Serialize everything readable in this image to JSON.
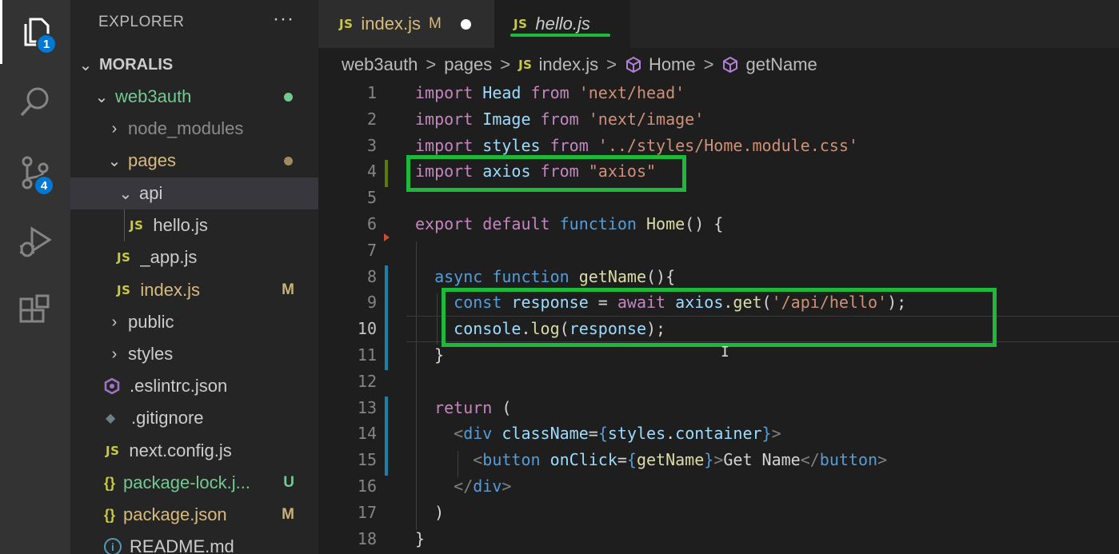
{
  "activity_bar": {
    "explorer_badge": "1",
    "scm_badge": "4"
  },
  "sidebar": {
    "title": "EXPLORER",
    "more_actions": "···",
    "root": "MORALIS",
    "items": [
      {
        "label": "web3auth",
        "decoration": ""
      },
      {
        "label": "node_modules",
        "decoration": ""
      },
      {
        "label": "pages",
        "decoration": ""
      },
      {
        "label": "api",
        "decoration": ""
      },
      {
        "label": "hello.js",
        "decoration": ""
      },
      {
        "label": "_app.js",
        "decoration": ""
      },
      {
        "label": "index.js",
        "decoration": "M"
      },
      {
        "label": "public",
        "decoration": ""
      },
      {
        "label": "styles",
        "decoration": ""
      },
      {
        "label": ".eslintrc.json",
        "decoration": ""
      },
      {
        "label": ".gitignore",
        "decoration": ""
      },
      {
        "label": "next.config.js",
        "decoration": ""
      },
      {
        "label": "package-lock.j...",
        "decoration": "U"
      },
      {
        "label": "package.json",
        "decoration": "M"
      },
      {
        "label": "README.md",
        "decoration": ""
      }
    ],
    "js_icon": "JS",
    "json_icon": "{}"
  },
  "tabs": [
    {
      "icon": "JS",
      "label": "index.js",
      "status": "M"
    },
    {
      "icon": "JS",
      "label": "hello.js",
      "status": ""
    }
  ],
  "breadcrumb": {
    "items": [
      "web3auth",
      "pages",
      "index.js",
      "Home",
      "getName"
    ],
    "separator": ">"
  },
  "editor": {
    "line_numbers": [
      "1",
      "2",
      "3",
      "4",
      "5",
      "6",
      "7",
      "8",
      "9",
      "10",
      "11",
      "12",
      "13",
      "14",
      "15",
      "16",
      "17",
      "18"
    ],
    "lines": [
      [
        [
          "kw-pink",
          "import"
        ],
        [
          "",
          ""
        ],
        [
          "id",
          " Head"
        ],
        [
          "kw-pink",
          " from"
        ],
        [
          "str",
          " 'next/head'"
        ]
      ],
      [
        [
          "kw-pink",
          "import"
        ],
        [
          "id",
          " Image"
        ],
        [
          "kw-pink",
          " from"
        ],
        [
          "str",
          " 'next/image'"
        ]
      ],
      [
        [
          "kw-pink",
          "import"
        ],
        [
          "id",
          " styles"
        ],
        [
          "kw-pink",
          " from"
        ],
        [
          "str",
          " '../styles/Home.module.css'"
        ]
      ],
      [
        [
          "kw-pink",
          "import"
        ],
        [
          "id",
          " axios"
        ],
        [
          "kw-pink",
          " from"
        ],
        [
          "str",
          " \"axios\""
        ]
      ],
      [],
      [
        [
          "kw-pink",
          "export"
        ],
        [
          "kw-pink",
          " default"
        ],
        [
          "kw-blue",
          " function"
        ],
        [
          "fn",
          " Home"
        ],
        [
          "",
          "() {"
        ]
      ],
      [],
      [
        [
          "",
          "  "
        ],
        [
          "kw-blue",
          "async"
        ],
        [
          "kw-blue",
          " function"
        ],
        [
          "fn",
          " getName"
        ],
        [
          "",
          "(){"
        ]
      ],
      [
        [
          "",
          "    "
        ],
        [
          "kw-blue",
          "const"
        ],
        [
          "id",
          " response"
        ],
        [
          "",
          " = "
        ],
        [
          "kw-pink",
          "await"
        ],
        [
          "id",
          " axios"
        ],
        [
          "",
          "."
        ],
        [
          "fn",
          "get"
        ],
        [
          "",
          "("
        ],
        [
          "str",
          "'/api/hello'"
        ],
        [
          "",
          ");"
        ]
      ],
      [
        [
          "",
          "    "
        ],
        [
          "id",
          "console"
        ],
        [
          "",
          "."
        ],
        [
          "fn",
          "log"
        ],
        [
          "",
          "("
        ],
        [
          "id",
          "response"
        ],
        [
          "",
          ");"
        ]
      ],
      [
        [
          "",
          "  }"
        ]
      ],
      [],
      [
        [
          "",
          "  "
        ],
        [
          "kw-pink",
          "return"
        ],
        [
          "",
          " ("
        ]
      ],
      [
        [
          "",
          "    "
        ],
        [
          "punct",
          "<"
        ],
        [
          "tag",
          "div"
        ],
        [
          "id",
          " className"
        ],
        [
          "",
          "="
        ],
        [
          "kw-blue",
          "{"
        ],
        [
          "id",
          "styles"
        ],
        [
          "",
          "."
        ],
        [
          "id",
          "container"
        ],
        [
          "kw-blue",
          "}"
        ],
        [
          "punct",
          ">"
        ]
      ],
      [
        [
          "",
          "      "
        ],
        [
          "punct",
          "<"
        ],
        [
          "tag",
          "button"
        ],
        [
          "id",
          " onClick"
        ],
        [
          "",
          "="
        ],
        [
          "kw-blue",
          "{"
        ],
        [
          "fn",
          "getName"
        ],
        [
          "kw-blue",
          "}"
        ],
        [
          "punct",
          ">"
        ],
        [
          "",
          "Get Name"
        ],
        [
          "punct",
          "</"
        ],
        [
          "tag",
          "button"
        ],
        [
          "punct",
          ">"
        ]
      ],
      [
        [
          "",
          "    "
        ],
        [
          "punct",
          "</"
        ],
        [
          "tag",
          "div"
        ],
        [
          "punct",
          ">"
        ]
      ],
      [
        [
          "",
          "  )"
        ]
      ],
      [
        [
          "",
          "}"
        ]
      ]
    ],
    "active_line": "10"
  },
  "colors": {
    "highlight_box": "#1eb93a",
    "js_icon": "#cbcb41",
    "modified": "#c8b277",
    "untracked": "#73c991"
  }
}
